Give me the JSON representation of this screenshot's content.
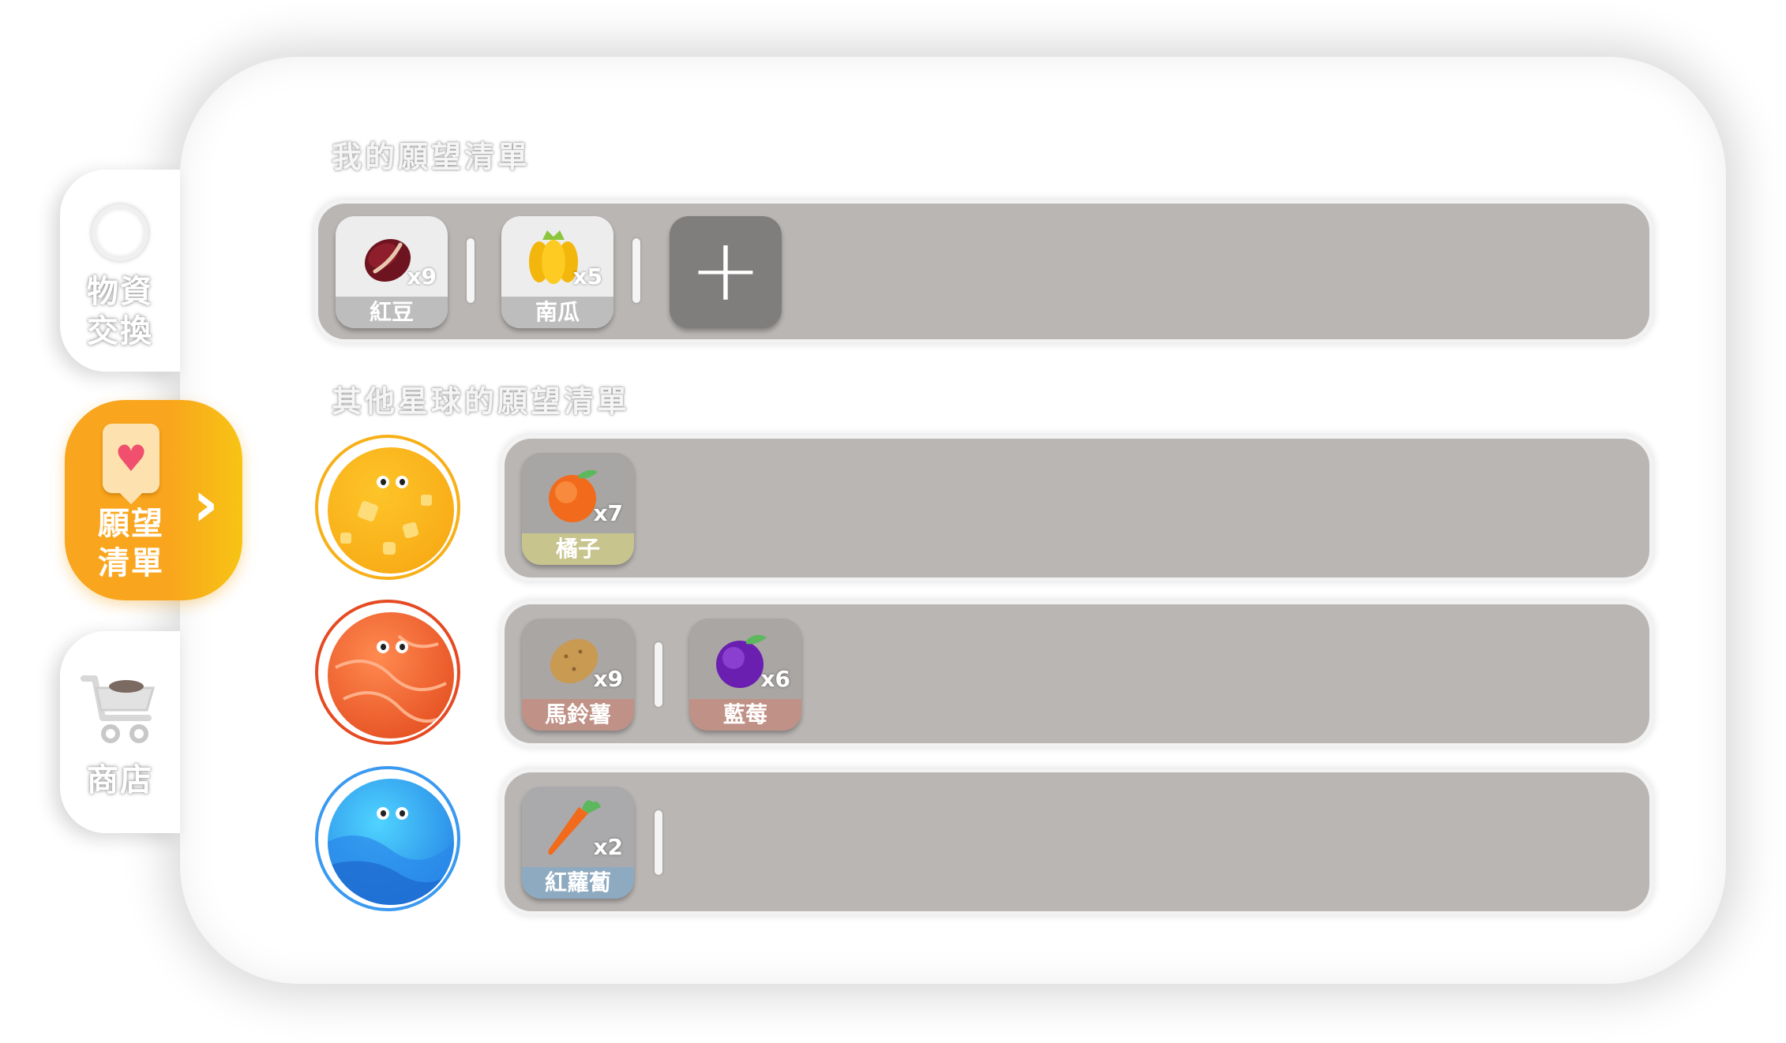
{
  "tabs": {
    "trade": {
      "label_line1": "物資",
      "label_line2": "交換",
      "icon": "circle-icon",
      "selected": false
    },
    "wishlist": {
      "label_line1": "願望",
      "label_line2": "清單",
      "icon": "heart-card-icon",
      "selected": true
    },
    "shop": {
      "label_line1": "商店",
      "icon": "shopping-cart-icon",
      "selected": false
    }
  },
  "my_wishlist": {
    "title": "我的願望清單",
    "items": [
      {
        "name": "紅豆",
        "qty": "x9",
        "icon": "red-bean-icon"
      },
      {
        "name": "南瓜",
        "qty": "x5",
        "icon": "pumpkin-icon"
      }
    ],
    "add_label": "+"
  },
  "other_wishlists": {
    "title": "其他星球的願望清單",
    "planets": [
      {
        "planet": "yellow-planet",
        "items": [
          {
            "name": "橘子",
            "qty": "x7",
            "icon": "orange-icon"
          }
        ]
      },
      {
        "planet": "red-planet",
        "items": [
          {
            "name": "馬鈴薯",
            "qty": "x9",
            "icon": "potato-icon"
          },
          {
            "name": "藍莓",
            "qty": "x6",
            "icon": "blueberry-icon"
          }
        ]
      },
      {
        "planet": "blue-planet",
        "items": [
          {
            "name": "紅蘿蔔",
            "qty": "x2",
            "icon": "carrot-icon"
          }
        ]
      }
    ]
  },
  "colors": {
    "accent": "#f9a51d",
    "row_bg": "#bab6b4",
    "add_button": "#7f7e7d"
  }
}
